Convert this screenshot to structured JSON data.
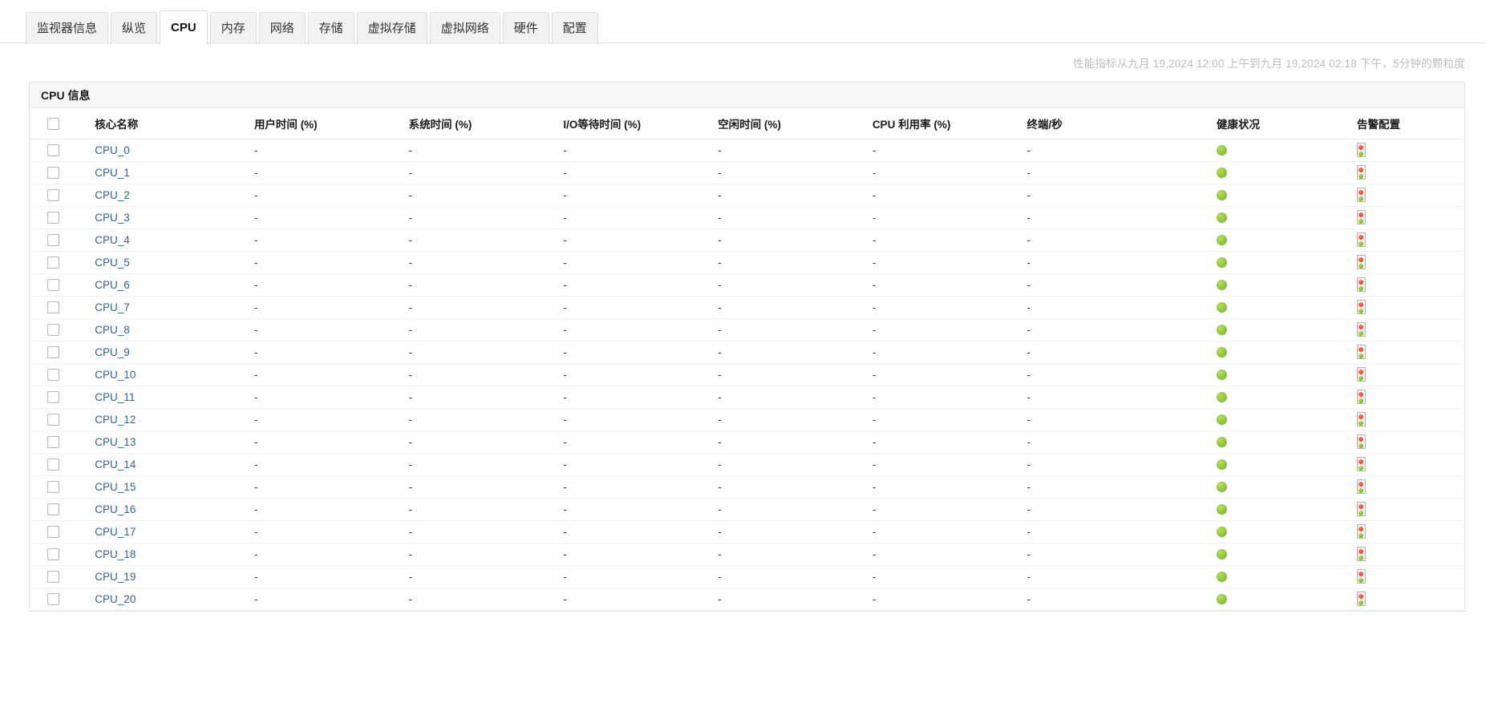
{
  "tabs": [
    {
      "label": "监视器信息",
      "active": false
    },
    {
      "label": "纵览",
      "active": false
    },
    {
      "label": "CPU",
      "active": true
    },
    {
      "label": "内存",
      "active": false
    },
    {
      "label": "网络",
      "active": false
    },
    {
      "label": "存储",
      "active": false
    },
    {
      "label": "虚拟存储",
      "active": false
    },
    {
      "label": "虚拟网络",
      "active": false
    },
    {
      "label": "硬件",
      "active": false
    },
    {
      "label": "配置",
      "active": false
    }
  ],
  "meta": {
    "timespan_text": "性能指标从九月 19,2024 12:00 上午到九月 19,2024 02:18 下午，5分钟的颗粒度"
  },
  "panel": {
    "title": "CPU 信息"
  },
  "table": {
    "columns": [
      {
        "key": "select",
        "label": "",
        "class": "col-check"
      },
      {
        "key": "name",
        "label": "核心名称",
        "class": "col-name"
      },
      {
        "key": "user",
        "label": "用户时间 (%)",
        "class": "col-num"
      },
      {
        "key": "system",
        "label": "系统时间 (%)",
        "class": "col-num"
      },
      {
        "key": "iowait",
        "label": "I/O等待时间 (%)",
        "class": "col-num"
      },
      {
        "key": "idle",
        "label": "空闲时间 (%)",
        "class": "col-num"
      },
      {
        "key": "usage",
        "label": "CPU 利用率 (%)",
        "class": "col-num"
      },
      {
        "key": "term",
        "label": "终端/秒",
        "class": "col-term"
      },
      {
        "key": "health",
        "label": "健康状况",
        "class": "col-health"
      },
      {
        "key": "alert",
        "label": "告警配置",
        "class": "col-alert"
      }
    ],
    "header_checkbox_checked": false,
    "empty_value": "-",
    "health_status": "green",
    "alert_icon": "traffic-light-icon",
    "rows": [
      {
        "name": "CPU_0",
        "user": "-",
        "system": "-",
        "iowait": "-",
        "idle": "-",
        "usage": "-",
        "term": "-",
        "health": "green",
        "selected": false
      },
      {
        "name": "CPU_1",
        "user": "-",
        "system": "-",
        "iowait": "-",
        "idle": "-",
        "usage": "-",
        "term": "-",
        "health": "green",
        "selected": false
      },
      {
        "name": "CPU_2",
        "user": "-",
        "system": "-",
        "iowait": "-",
        "idle": "-",
        "usage": "-",
        "term": "-",
        "health": "green",
        "selected": false
      },
      {
        "name": "CPU_3",
        "user": "-",
        "system": "-",
        "iowait": "-",
        "idle": "-",
        "usage": "-",
        "term": "-",
        "health": "green",
        "selected": false
      },
      {
        "name": "CPU_4",
        "user": "-",
        "system": "-",
        "iowait": "-",
        "idle": "-",
        "usage": "-",
        "term": "-",
        "health": "green",
        "selected": false
      },
      {
        "name": "CPU_5",
        "user": "-",
        "system": "-",
        "iowait": "-",
        "idle": "-",
        "usage": "-",
        "term": "-",
        "health": "green",
        "selected": false
      },
      {
        "name": "CPU_6",
        "user": "-",
        "system": "-",
        "iowait": "-",
        "idle": "-",
        "usage": "-",
        "term": "-",
        "health": "green",
        "selected": false
      },
      {
        "name": "CPU_7",
        "user": "-",
        "system": "-",
        "iowait": "-",
        "idle": "-",
        "usage": "-",
        "term": "-",
        "health": "green",
        "selected": false
      },
      {
        "name": "CPU_8",
        "user": "-",
        "system": "-",
        "iowait": "-",
        "idle": "-",
        "usage": "-",
        "term": "-",
        "health": "green",
        "selected": false
      },
      {
        "name": "CPU_9",
        "user": "-",
        "system": "-",
        "iowait": "-",
        "idle": "-",
        "usage": "-",
        "term": "-",
        "health": "green",
        "selected": false
      },
      {
        "name": "CPU_10",
        "user": "-",
        "system": "-",
        "iowait": "-",
        "idle": "-",
        "usage": "-",
        "term": "-",
        "health": "green",
        "selected": false
      },
      {
        "name": "CPU_11",
        "user": "-",
        "system": "-",
        "iowait": "-",
        "idle": "-",
        "usage": "-",
        "term": "-",
        "health": "green",
        "selected": false
      },
      {
        "name": "CPU_12",
        "user": "-",
        "system": "-",
        "iowait": "-",
        "idle": "-",
        "usage": "-",
        "term": "-",
        "health": "green",
        "selected": false
      },
      {
        "name": "CPU_13",
        "user": "-",
        "system": "-",
        "iowait": "-",
        "idle": "-",
        "usage": "-",
        "term": "-",
        "health": "green",
        "selected": false
      },
      {
        "name": "CPU_14",
        "user": "-",
        "system": "-",
        "iowait": "-",
        "idle": "-",
        "usage": "-",
        "term": "-",
        "health": "green",
        "selected": false
      },
      {
        "name": "CPU_15",
        "user": "-",
        "system": "-",
        "iowait": "-",
        "idle": "-",
        "usage": "-",
        "term": "-",
        "health": "green",
        "selected": false
      },
      {
        "name": "CPU_16",
        "user": "-",
        "system": "-",
        "iowait": "-",
        "idle": "-",
        "usage": "-",
        "term": "-",
        "health": "green",
        "selected": false
      },
      {
        "name": "CPU_17",
        "user": "-",
        "system": "-",
        "iowait": "-",
        "idle": "-",
        "usage": "-",
        "term": "-",
        "health": "green",
        "selected": false
      },
      {
        "name": "CPU_18",
        "user": "-",
        "system": "-",
        "iowait": "-",
        "idle": "-",
        "usage": "-",
        "term": "-",
        "health": "green",
        "selected": false
      },
      {
        "name": "CPU_19",
        "user": "-",
        "system": "-",
        "iowait": "-",
        "idle": "-",
        "usage": "-",
        "term": "-",
        "health": "green",
        "selected": false
      },
      {
        "name": "CPU_20",
        "user": "-",
        "system": "-",
        "iowait": "-",
        "idle": "-",
        "usage": "-",
        "term": "-",
        "health": "green",
        "selected": false
      }
    ]
  },
  "colors": {
    "health_green": "#8cc63f",
    "alert_red": "#e8402a",
    "link_blue": "#2a64a8",
    "meta_gray": "#b9bcc4"
  }
}
